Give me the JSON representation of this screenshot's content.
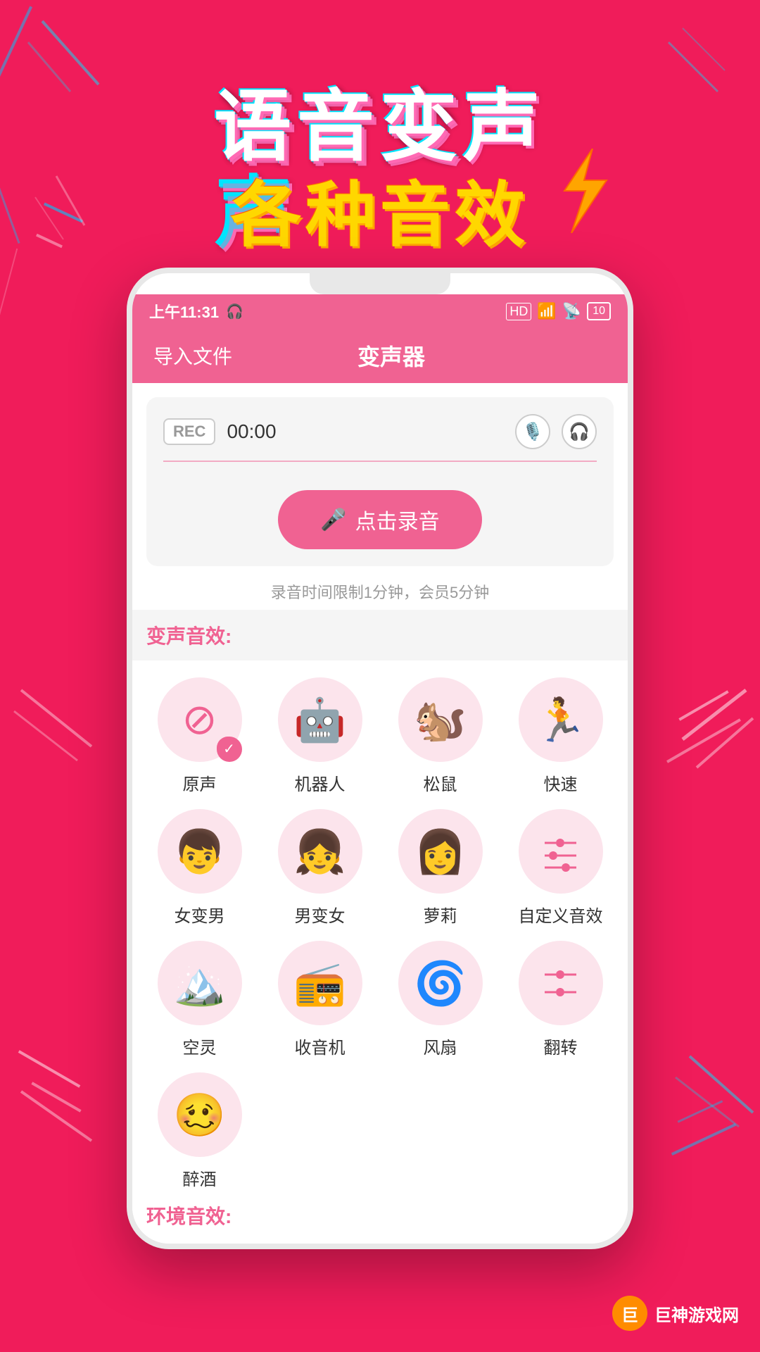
{
  "background_color": "#f01c5a",
  "header": {
    "title_line1": "语音变声",
    "title_line2": "各种音效"
  },
  "status_bar": {
    "time": "上午11:31",
    "signal": "HD",
    "battery": "10"
  },
  "app_bar": {
    "import_label": "导入文件",
    "title": "变声器"
  },
  "recording": {
    "rec_badge": "REC",
    "time": "00:00",
    "record_btn_label": "点击录音",
    "hint": "录音时间限制1分钟，会员5分钟"
  },
  "effects": {
    "section_label": "变声音效:",
    "items": [
      {
        "id": "original",
        "label": "原声",
        "icon": "🚫",
        "selected": true
      },
      {
        "id": "robot",
        "label": "机器人",
        "icon": "🤖",
        "selected": false
      },
      {
        "id": "squirrel",
        "label": "松鼠",
        "icon": "🐿️",
        "selected": false
      },
      {
        "id": "fast",
        "label": "快速",
        "icon": "🏃",
        "selected": false
      },
      {
        "id": "female-to-male",
        "label": "女变男",
        "icon": "👦",
        "selected": false
      },
      {
        "id": "male-to-female",
        "label": "男变女",
        "icon": "👧",
        "selected": false
      },
      {
        "id": "molly",
        "label": "萝莉",
        "icon": "👩",
        "selected": false
      },
      {
        "id": "custom",
        "label": "自定义音效",
        "icon": "🎛️",
        "selected": false
      },
      {
        "id": "ethereal",
        "label": "空灵",
        "icon": "⛺",
        "selected": false
      },
      {
        "id": "radio",
        "label": "收音机",
        "icon": "📻",
        "selected": false
      },
      {
        "id": "fan",
        "label": "风扇",
        "icon": "💨",
        "selected": false
      },
      {
        "id": "flip",
        "label": "翻转",
        "icon": "🎚️",
        "selected": false
      },
      {
        "id": "drunk",
        "label": "醉酒",
        "icon": "🥴",
        "selected": false
      }
    ]
  },
  "env_effects": {
    "section_label": "环境音效:"
  },
  "watermark": {
    "site": "巨神游戏网"
  }
}
